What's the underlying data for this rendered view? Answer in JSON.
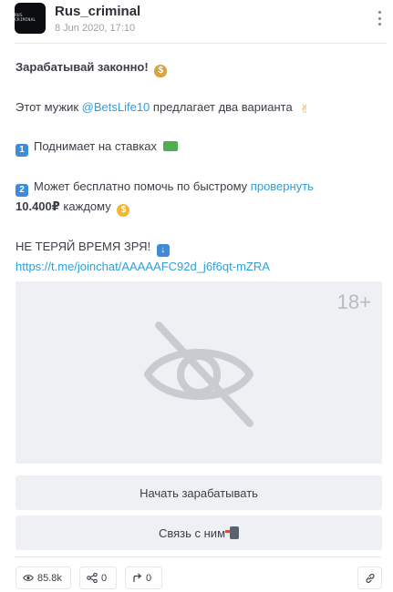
{
  "post": {
    "channel_name": "Rus_criminal",
    "avatar_text": "RUS CRIMINAL",
    "date": "8 Jun 2020, 17:10",
    "headline": "Зарабатывай законно!",
    "line2_prefix": "Этот мужик ",
    "mention": "@BetsLife10",
    "line2_suffix": " предлагает два варианта",
    "option1": "Поднимает на ставках",
    "option2_prefix": "Может бесплатно помочь по быстрому ",
    "option2_link": "провернуть",
    "option2_amount": "10.400₽",
    "option2_suffix": " каждому",
    "cta": "НЕ ТЕРЯЙ ВРЕМЯ ЗРЯ!",
    "invite_link": "https://t.me/joinchat/AAAAAFC92d_j6f6qt-mZRA",
    "key_1": "1",
    "key_2": "2"
  },
  "media": {
    "age_label": "18+",
    "icon": "eye-slash-icon"
  },
  "buttons": {
    "primary_label": "Начать зарабатывать",
    "secondary_label": "Связь с ним"
  },
  "stats": {
    "views": "85.8k",
    "shares": "0",
    "forwards": "0"
  },
  "colors": {
    "link": "#2f9fd8",
    "button_bg": "#eef0f3",
    "text": "#3a3f47",
    "muted": "#9aa1a9"
  }
}
